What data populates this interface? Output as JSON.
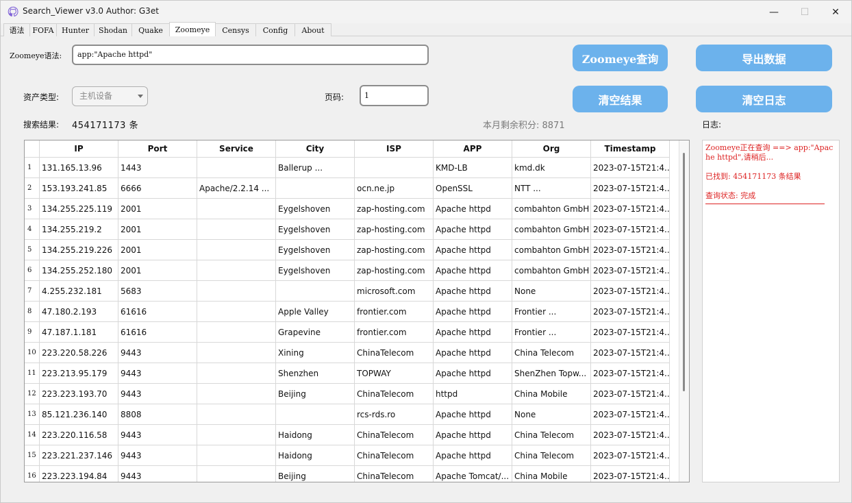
{
  "window": {
    "title": "Search_Viewer v3.0   Author:  G3et",
    "minimize": "—",
    "maximize": "☐",
    "close": "✕"
  },
  "tabs": [
    "语法",
    "FOFA",
    "Hunter",
    "Shodan",
    "Quake",
    "Zoomeye",
    "Censys",
    "Config",
    "About"
  ],
  "active_tab": "Zoomeye",
  "form": {
    "query_label": "Zoomeye语法:",
    "query_value": "app:\"Apache httpd\"",
    "asset_type_label": "资产类型:",
    "asset_type_value": "主机设备",
    "page_label": "页码:",
    "page_value": "1",
    "results_label": "搜索结果:",
    "results_count": "454171173 条",
    "credits_text": "本月剩余积分: 8871",
    "log_label": "日志:"
  },
  "buttons": {
    "query": "Zoomeye查询",
    "export": "导出数据",
    "clear_results": "清空结果",
    "clear_log": "清空日志"
  },
  "table": {
    "columns": [
      "",
      "IP",
      "Port",
      "Service",
      "City",
      "ISP",
      "APP",
      "Org",
      "Timestamp"
    ],
    "rows": [
      [
        "1",
        "131.165.13.96",
        "1443",
        "",
        "Ballerup ...",
        "",
        "KMD-LB",
        "kmd.dk",
        "2023-07-15T21:4..."
      ],
      [
        "2",
        "153.193.241.85",
        "6666",
        "Apache/2.2.14 ...",
        "",
        "ocn.ne.jp",
        "OpenSSL",
        "NTT ...",
        "2023-07-15T21:4..."
      ],
      [
        "3",
        "134.255.225.119",
        "2001",
        "",
        "Eygelshoven",
        "zap-hosting.com",
        "Apache httpd",
        "combahton GmbH",
        "2023-07-15T21:4..."
      ],
      [
        "4",
        "134.255.219.2",
        "2001",
        "",
        "Eygelshoven",
        "zap-hosting.com",
        "Apache httpd",
        "combahton GmbH",
        "2023-07-15T21:4..."
      ],
      [
        "5",
        "134.255.219.226",
        "2001",
        "",
        "Eygelshoven",
        "zap-hosting.com",
        "Apache httpd",
        "combahton GmbH",
        "2023-07-15T21:4..."
      ],
      [
        "6",
        "134.255.252.180",
        "2001",
        "",
        "Eygelshoven",
        "zap-hosting.com",
        "Apache httpd",
        "combahton GmbH",
        "2023-07-15T21:4..."
      ],
      [
        "7",
        "4.255.232.181",
        "5683",
        "",
        "",
        "microsoft.com",
        "Apache httpd",
        "None",
        "2023-07-15T21:4..."
      ],
      [
        "8",
        "47.180.2.193",
        "61616",
        "",
        "Apple Valley",
        "frontier.com",
        "Apache httpd",
        "Frontier ...",
        "2023-07-15T21:4..."
      ],
      [
        "9",
        "47.187.1.181",
        "61616",
        "",
        "Grapevine",
        "frontier.com",
        "Apache httpd",
        "Frontier ...",
        "2023-07-15T21:4..."
      ],
      [
        "10",
        "223.220.58.226",
        "9443",
        "",
        "Xining",
        "ChinaTelecom",
        "Apache httpd",
        "China Telecom",
        "2023-07-15T21:4..."
      ],
      [
        "11",
        "223.213.95.179",
        "9443",
        "",
        "Shenzhen",
        "TOPWAY",
        "Apache httpd",
        "ShenZhen Topw...",
        "2023-07-15T21:4..."
      ],
      [
        "12",
        "223.223.193.70",
        "9443",
        "",
        "Beijing",
        "ChinaTelecom",
        "httpd",
        "China Mobile",
        "2023-07-15T21:4..."
      ],
      [
        "13",
        "85.121.236.140",
        "8808",
        "",
        "",
        "rcs-rds.ro",
        "Apache httpd",
        "None",
        "2023-07-15T21:4..."
      ],
      [
        "14",
        "223.220.116.58",
        "9443",
        "",
        "Haidong",
        "ChinaTelecom",
        "Apache httpd",
        "China Telecom",
        "2023-07-15T21:4..."
      ],
      [
        "15",
        "223.221.237.146",
        "9443",
        "",
        "Haidong",
        "ChinaTelecom",
        "Apache httpd",
        "China Telecom",
        "2023-07-15T21:4..."
      ],
      [
        "16",
        "223.223.194.84",
        "9443",
        "",
        "Beijing",
        "ChinaTelecom",
        "Apache Tomcat/...",
        "China Mobile",
        "2023-07-15T21:4..."
      ]
    ]
  },
  "log": {
    "lines": [
      "Zoomeye正在查询 ==> app:\"Apache httpd\",请稍后...",
      "已找到: 454171173 条结果",
      "查询状态: 完成"
    ]
  },
  "colors": {
    "button": "#6cb2ec",
    "log_text": "#dd2222"
  }
}
